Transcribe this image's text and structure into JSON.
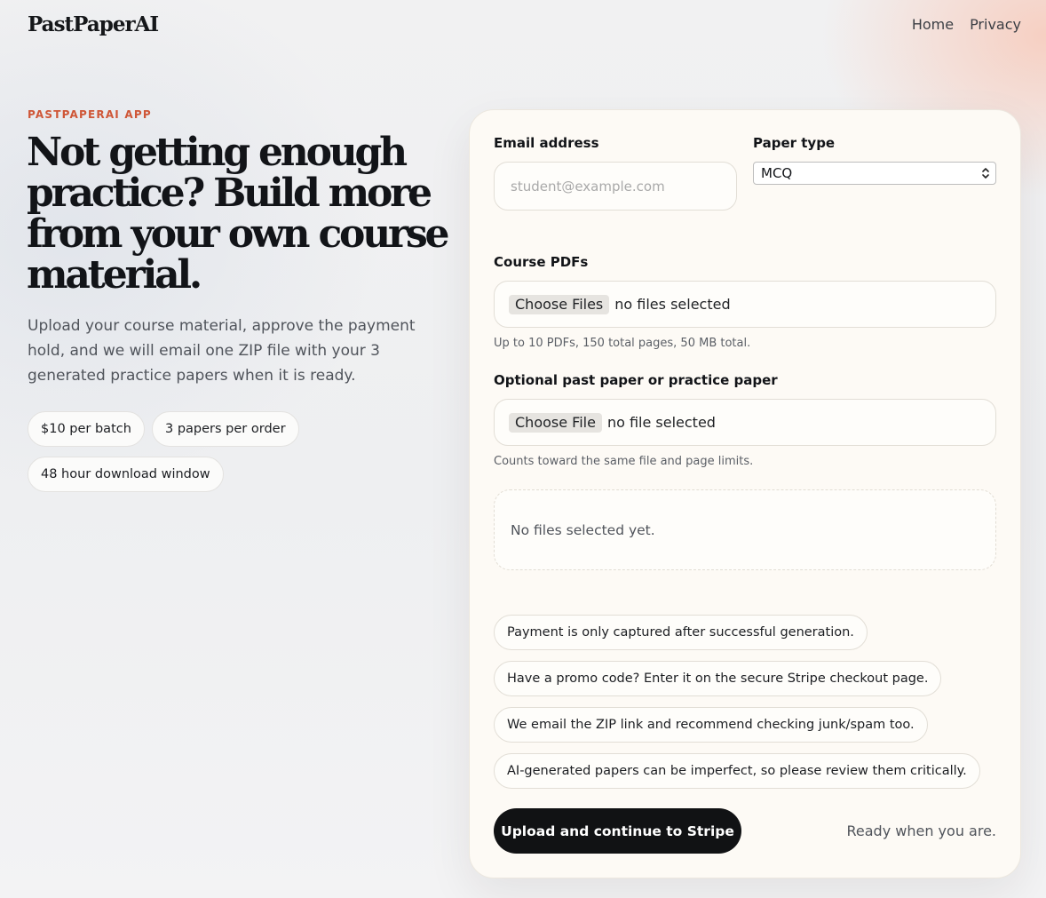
{
  "header": {
    "brand": "PastPaperAI",
    "nav": [
      {
        "label": "Home"
      },
      {
        "label": "Privacy"
      }
    ]
  },
  "hero": {
    "eyebrow": "PASTPAPERAI APP",
    "title": "Not getting enough practice? Build more from your own course material.",
    "subtitle": "Upload your course material, approve the payment hold, and we will email one ZIP file with your 3 generated practice papers when it is ready.",
    "pills": [
      "$10 per batch",
      "3 papers per order",
      "48 hour download window"
    ]
  },
  "form": {
    "email_label": "Email address",
    "email_placeholder": "student@example.com",
    "email_value": "",
    "paper_type_label": "Paper type",
    "paper_type_value": "MCQ",
    "course_pdfs_label": "Course PDFs",
    "course_pdfs_button": "Choose Files",
    "course_pdfs_status": "no files selected",
    "course_pdfs_hint": "Up to 10 PDFs, 150 total pages, 50 MB total.",
    "past_paper_label": "Optional past paper or practice paper",
    "past_paper_button": "Choose File",
    "past_paper_status": "no file selected",
    "past_paper_hint": "Counts toward the same file and page limits.",
    "selected_files_empty": "No files selected yet.",
    "notes": [
      "Payment is only captured after successful generation.",
      "Have a promo code? Enter it on the secure Stripe checkout page.",
      "We email the ZIP link and recommend checking junk/spam too.",
      "AI-generated papers can be imperfect, so please review them critically."
    ],
    "submit_label": "Upload and continue to Stripe",
    "status_text": "Ready when you are."
  },
  "colors": {
    "accent": "#cf5637",
    "button_bg": "#111214",
    "card_bg": "#fdfaf5"
  },
  "icons": {
    "select_arrows": "chevron-up-down-icon"
  }
}
